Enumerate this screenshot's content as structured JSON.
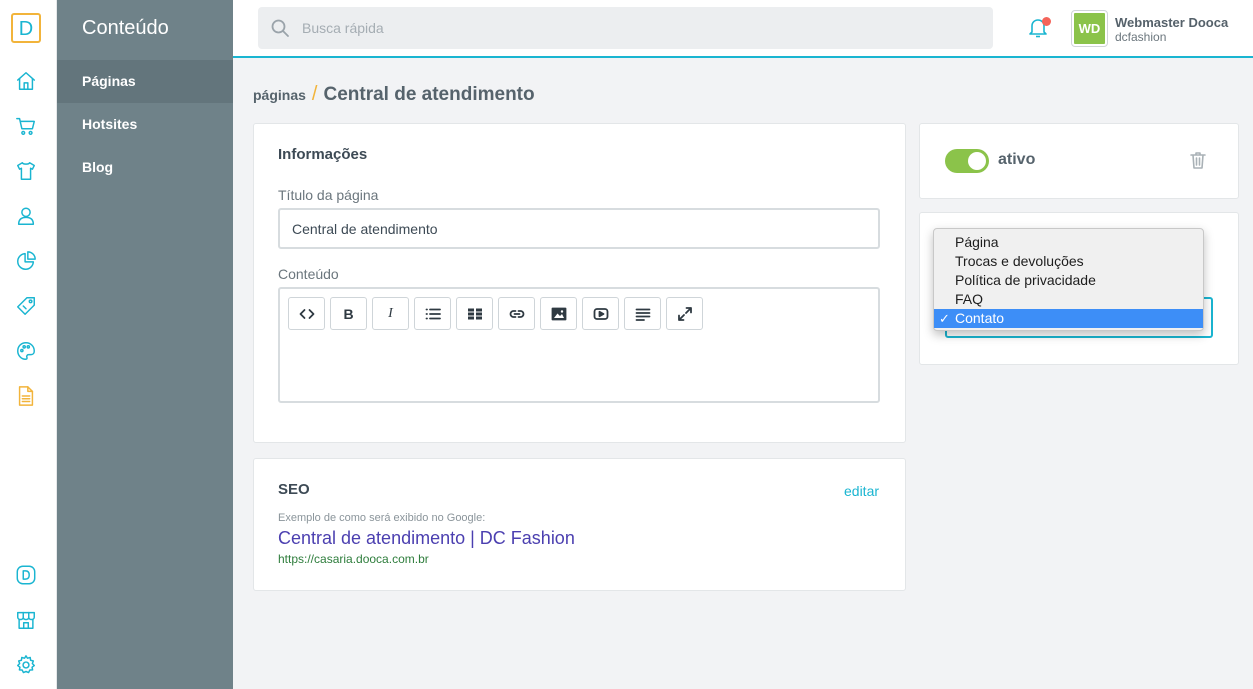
{
  "rail": {
    "logo_letter": "D",
    "icons": [
      "home-icon",
      "cart-icon",
      "shirt-icon",
      "user-icon",
      "pie-chart-icon",
      "tag-icon",
      "palette-icon",
      "document-icon",
      "dooca-icon",
      "store-icon",
      "gear-icon"
    ],
    "brand_color": "#1ab5d1",
    "active_color": "#f2b43b",
    "dooca_letter": "D"
  },
  "subnav": {
    "title": "Conteúdo",
    "items": [
      {
        "label": "Páginas",
        "selected": true
      },
      {
        "label": "Hotsites",
        "selected": false
      },
      {
        "label": "Blog",
        "selected": false
      }
    ]
  },
  "topbar": {
    "search_placeholder": "Busca rápida",
    "notifications": "has-unread",
    "user": {
      "initials": "WD",
      "name": "Webmaster Dooca",
      "store": "dcfashion"
    }
  },
  "breadcrumb": {
    "parent": "páginas",
    "separator": "/",
    "current": "Central de atendimento"
  },
  "info_card": {
    "title": "Informações",
    "title_label": "Título da página",
    "title_value": "Central de atendimento",
    "content_label": "Conteúdo",
    "toolbar": [
      "code-icon",
      "bold-icon",
      "italic-icon",
      "list-icon",
      "table-icon",
      "link-icon",
      "image-icon",
      "video-icon",
      "align-icon",
      "fullscreen-icon"
    ],
    "bold_glyph": "B",
    "italic_glyph": "I"
  },
  "seo_card": {
    "title": "SEO",
    "edit_label": "editar",
    "caption": "Exemplo de como será exibido no Google:",
    "preview_title": "Central de atendimento | DC Fashion",
    "preview_url": "https://casaria.dooca.com.br"
  },
  "status_card": {
    "active": true,
    "status_label": "ativo"
  },
  "type_select": {
    "options": [
      {
        "label": "Página",
        "selected": false
      },
      {
        "label": "Trocas e devoluções",
        "selected": false
      },
      {
        "label": "Política de privacidade",
        "selected": false
      },
      {
        "label": "FAQ",
        "selected": false
      },
      {
        "label": "Contato",
        "selected": true
      }
    ],
    "check_glyph": "✓",
    "highlight_color": "#3d8ef7"
  }
}
